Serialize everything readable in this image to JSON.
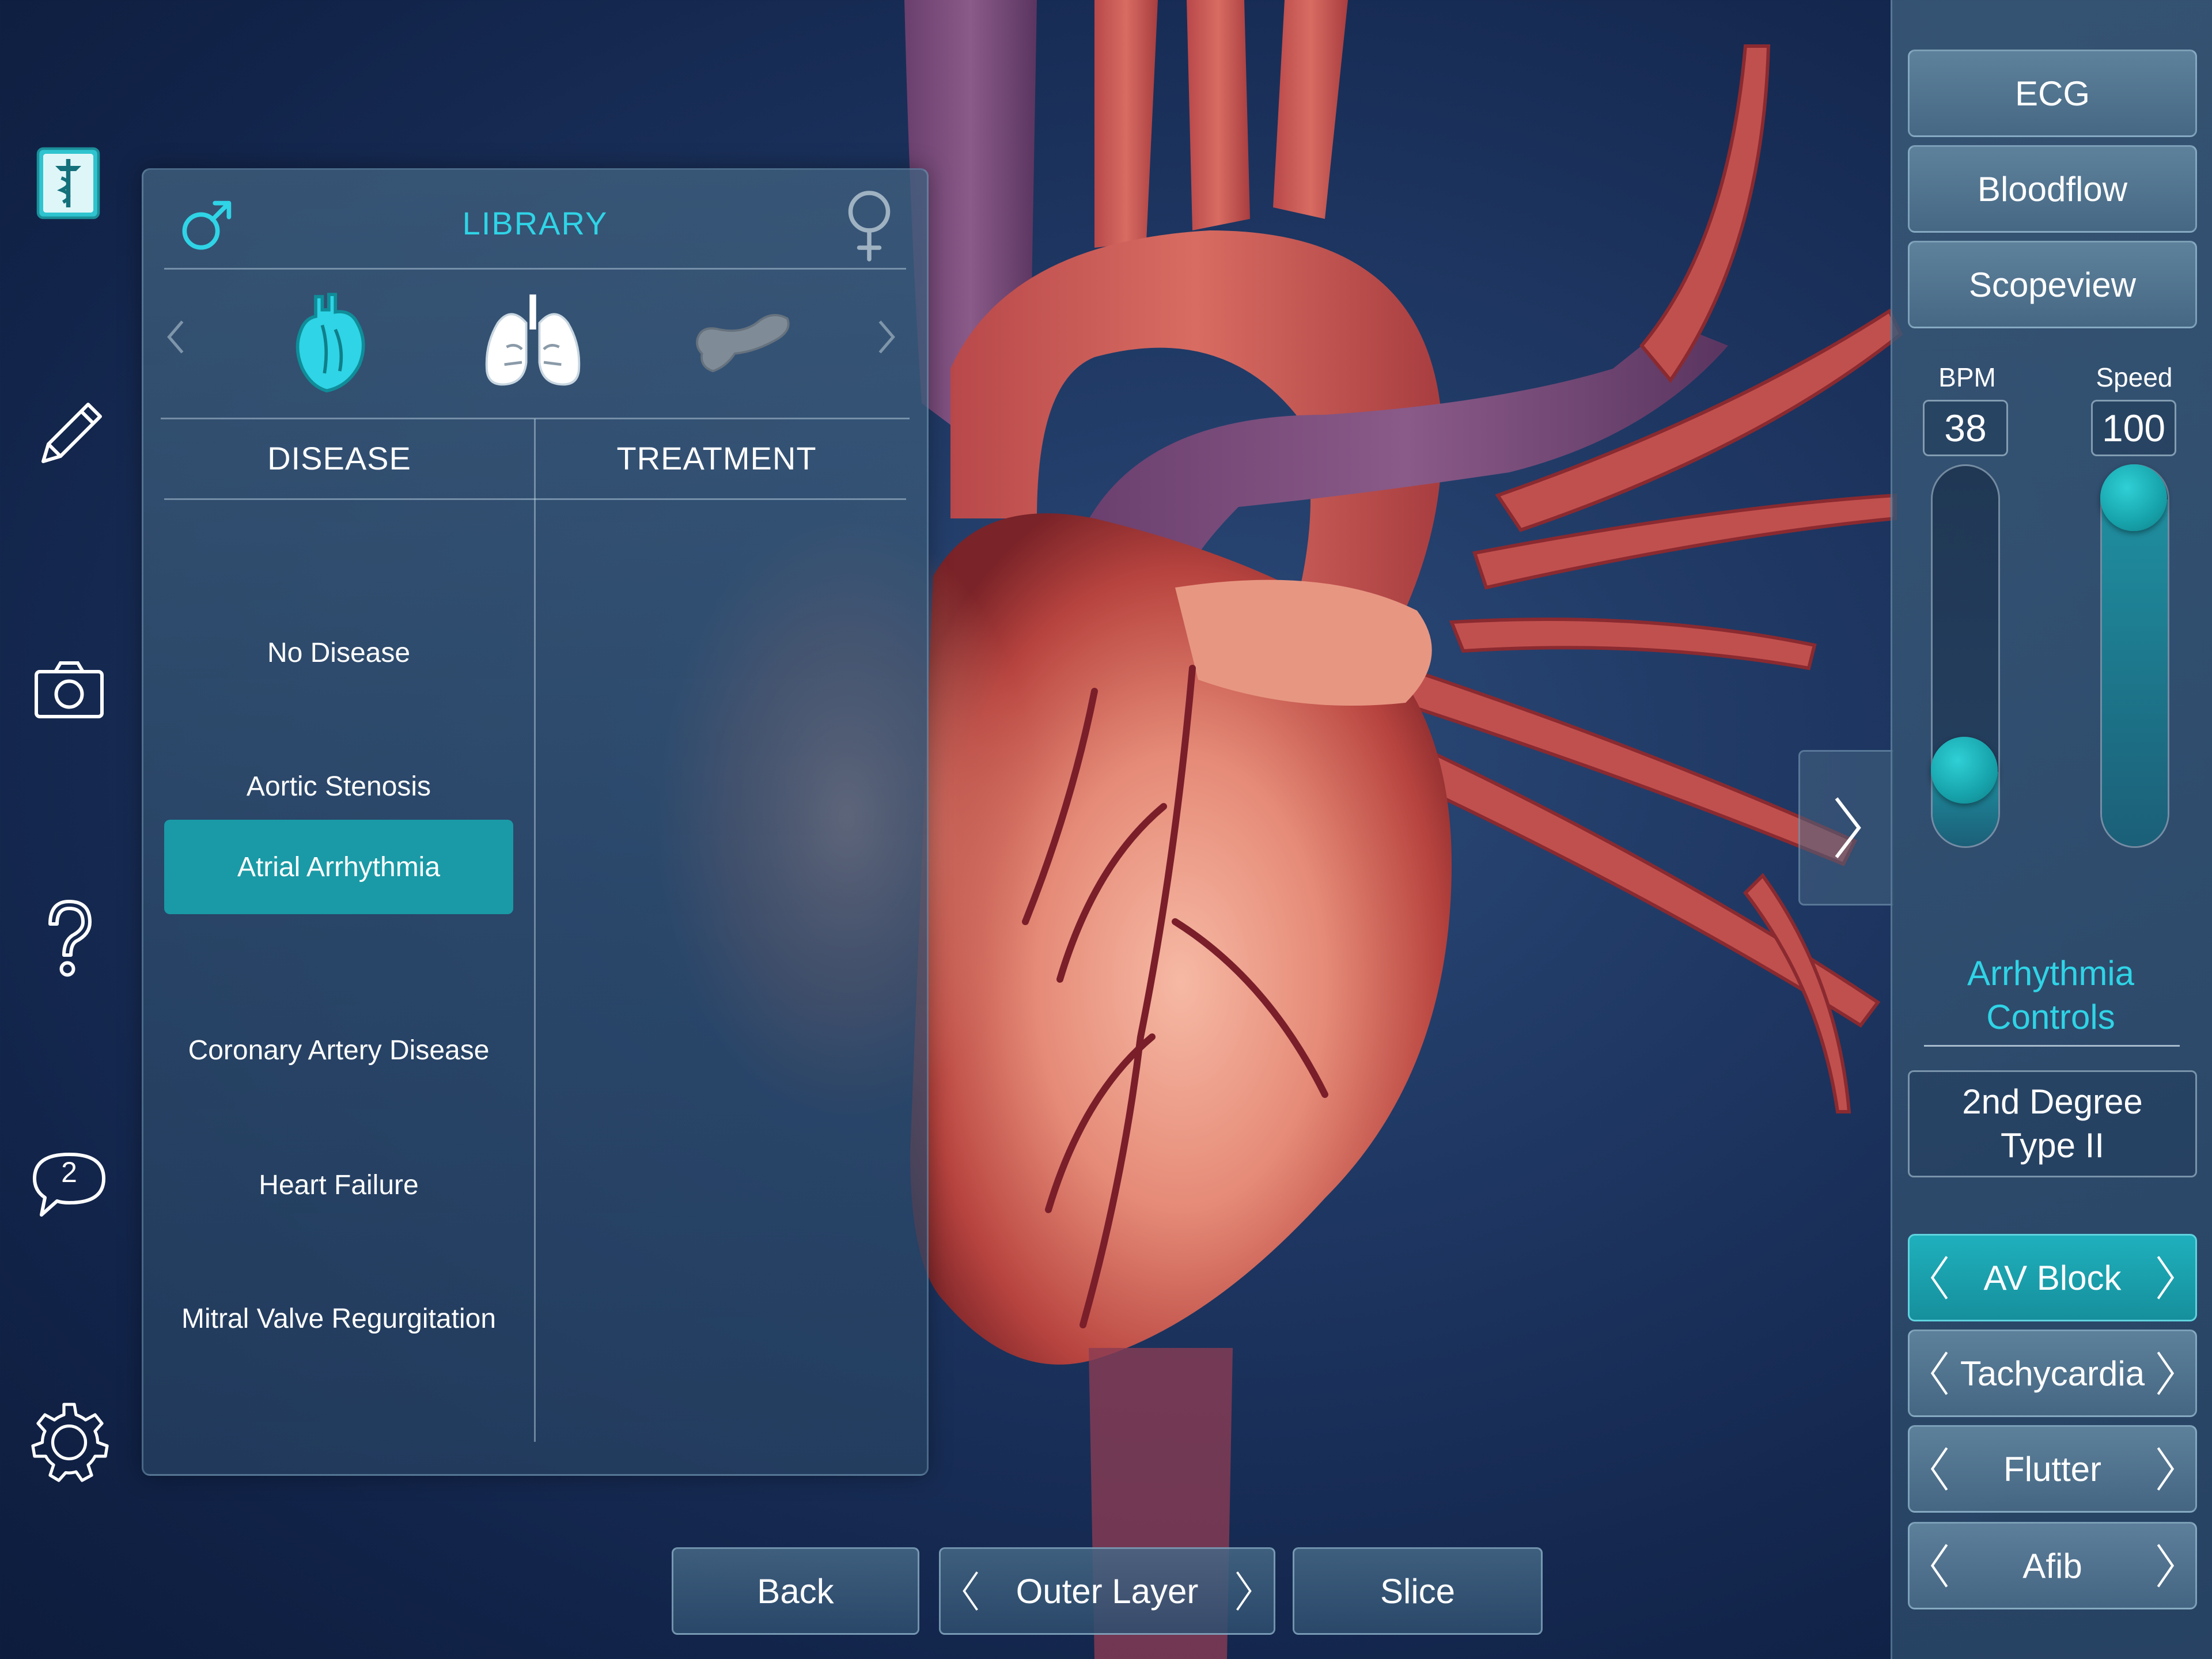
{
  "toolbar": {
    "icons": [
      "medical-book-icon",
      "pencil-icon",
      "camera-icon",
      "help-icon",
      "chat-icon",
      "settings-icon"
    ],
    "chat_badge": "2"
  },
  "library": {
    "title": "LIBRARY",
    "organs": [
      "heart",
      "lungs",
      "pancreas"
    ],
    "col_disease": "DISEASE",
    "col_treatment": "TREATMENT",
    "diseases": [
      {
        "label": "No Disease"
      },
      {
        "label": "Aortic Stenosis"
      },
      {
        "label": "Atrial Arrhythmia",
        "selected": true
      },
      {
        "label": "Coronary Artery Disease"
      },
      {
        "label": "Heart Failure"
      },
      {
        "label": "Mitral Valve Regurgitation"
      }
    ]
  },
  "controls": {
    "ecg": "ECG",
    "bloodflow": "Bloodflow",
    "scopeview": "Scopeview",
    "bpm_label": "BPM",
    "bpm_value": "38",
    "bpm_level": 0.13,
    "speed_label": "Speed",
    "speed_value": "100",
    "speed_level": 1.0,
    "arrhythmia_title_1": "Arrhythmia",
    "arrhythmia_title_2": "Controls",
    "mode_line_1": "2nd Degree",
    "mode_line_2": "Type II",
    "options": [
      {
        "label": "AV Block",
        "active": true
      },
      {
        "label": "Tachycardia"
      },
      {
        "label": "Flutter"
      },
      {
        "label": "Afib"
      }
    ]
  },
  "bottom": {
    "back": "Back",
    "layer": "Outer Layer",
    "slice": "Slice"
  },
  "colors": {
    "accent": "#2fd4e6",
    "selected": "#1a9aa6"
  }
}
